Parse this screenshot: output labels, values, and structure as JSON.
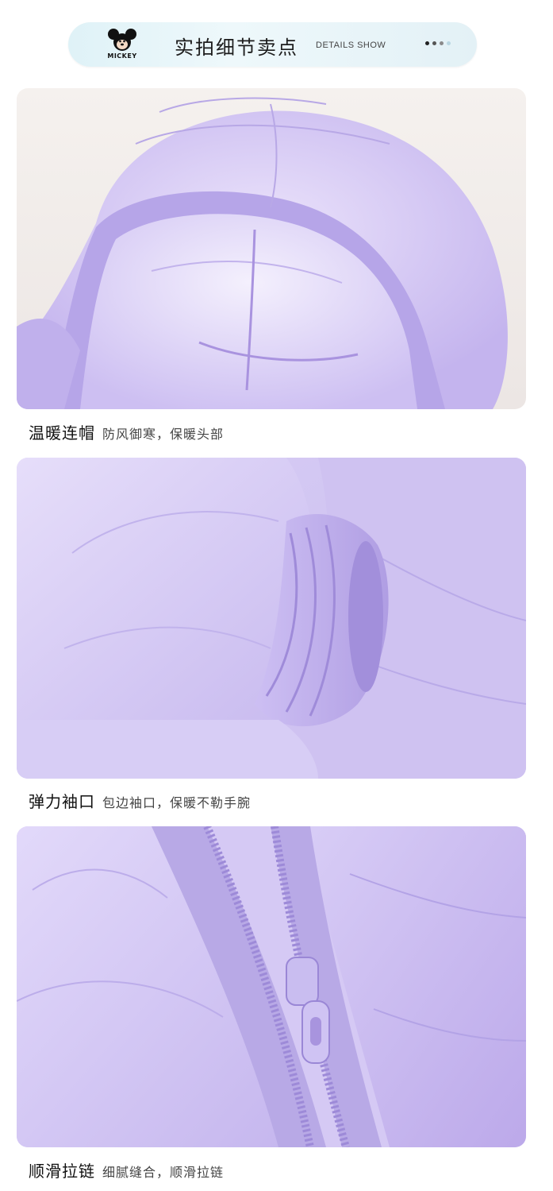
{
  "header": {
    "logo_text": "MICKEY",
    "title": "实拍细节卖点",
    "subtitle": "DETAILS SHOW",
    "dot_colors": [
      "#222222",
      "#555555",
      "#8a8a8a",
      "#b9d7e2"
    ]
  },
  "details": [
    {
      "title": "温暖连帽",
      "desc": "防风御寒，保暖头部",
      "image": "hood-closeup"
    },
    {
      "title": "弹力袖口",
      "desc": "包边袖口，保暖不勒手腕",
      "image": "cuff-closeup"
    },
    {
      "title": "顺滑拉链",
      "desc": "细腻缝合，顺滑拉链",
      "image": "zipper-closeup"
    }
  ],
  "colors": {
    "fabric_light": "#ddd4f5",
    "fabric_mid": "#c7b9ef",
    "fabric_dark": "#a896de",
    "header_bg": "#e6f4f8"
  }
}
